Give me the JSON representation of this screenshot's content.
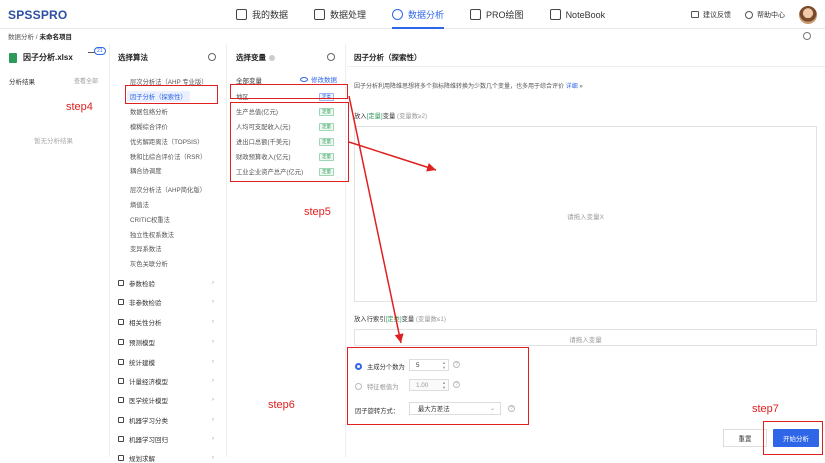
{
  "app": {
    "logo": "SPSSPRO",
    "nav": [
      {
        "label": "我的数据",
        "icon": "layers-icon"
      },
      {
        "label": "数据处理",
        "icon": "cube-icon"
      },
      {
        "label": "数据分析",
        "icon": "pie-chart-icon"
      },
      {
        "label": "PRO绘图",
        "icon": "sparkle-icon"
      },
      {
        "label": "NoteBook",
        "icon": "notebook-icon"
      }
    ],
    "active_nav": "数据分析",
    "feedback": "建议反馈",
    "help": "帮助中心"
  },
  "breadcrumb": {
    "root": "数据分析 /",
    "current": "未命名项目"
  },
  "sidebar": {
    "file_name": "因子分析.xlsx",
    "filter_count": "21",
    "results_title": "分析结果",
    "view_all": "查看全部",
    "empty": "暂无分析结果"
  },
  "algorithms": {
    "header": "选择算法",
    "items": [
      "层次分析法（AHP 专业版）",
      "因子分析（探索性）",
      "数据包络分析",
      "模糊综合评价",
      "优劣解距离法（TOPSIS）",
      "秩和比综合评价法（RSR）",
      "耦合协调度",
      "层次分析法（AHP简化版）",
      "熵值法",
      "CRITIC权重法",
      "独立性权系数法",
      "变异系数法",
      "灰色关联分析"
    ],
    "selected": "因子分析（探索性）",
    "categories": [
      "参数检验",
      "非参数检验",
      "相关性分析",
      "预测模型",
      "统计建模",
      "计量经济模型",
      "医学统计模型",
      "机器学习分类",
      "机器学习回归",
      "规划求解"
    ]
  },
  "variables": {
    "header": "选择变量",
    "all_label": "全部变量",
    "edit_label": "修改数据",
    "items": [
      {
        "name": "地区",
        "type": "定类"
      },
      {
        "name": "生产总值(亿元)",
        "type": "定量"
      },
      {
        "name": "人均可支配收入(元)",
        "type": "定量"
      },
      {
        "name": "进出口总额(千美元)",
        "type": "定量"
      },
      {
        "name": "财政预算收入(亿元)",
        "type": "定量"
      },
      {
        "name": "工业企业资产总产(亿元)",
        "type": "定量"
      }
    ]
  },
  "config": {
    "header": "因子分析（探索性）",
    "description": "因子分析利用降维思想将多个指标降维转换为少数几个变量，也多用于综合评价",
    "detail_link": "详细",
    "drop_x": {
      "prefix": "放入",
      "type": "[定量]",
      "suffix": "变量",
      "hint": "(变量数≥2)",
      "placeholder": "请拖入变量X"
    },
    "drop_row": {
      "prefix": "放入行索引",
      "type": "[定类]",
      "suffix": "变量",
      "hint": "(变量数≤1)",
      "placeholder": "请拖入变量"
    },
    "options": {
      "num_factors_label": "主成分个数为",
      "num_factors": "5",
      "eigen_label": "特征根值为",
      "eigen": "1.00",
      "rotation_label": "因子旋转方式：",
      "rotation": "最大方差法"
    },
    "reset": "重置",
    "run": "开始分析"
  },
  "annotations": {
    "step4": "step4",
    "step5": "step5",
    "step6": "step6",
    "step7": "step7"
  }
}
